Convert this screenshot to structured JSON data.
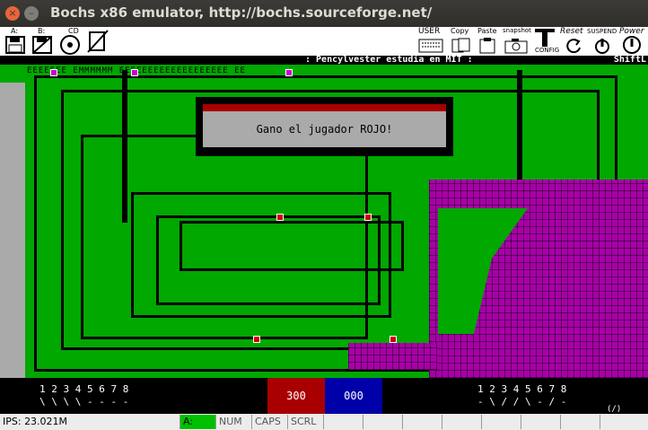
{
  "window": {
    "title": "Bochs x86 emulator, http://bochs.sourceforge.net/",
    "close_glyph": "×",
    "min_glyph": "–"
  },
  "toolbar": {
    "floppy_a": "A:",
    "floppy_b": "B:",
    "cdrom": "CD",
    "user": "USER",
    "copy": "Copy",
    "paste": "Paste",
    "snapshot": "snapshot",
    "config": "CONFIG",
    "reset": "Reset",
    "suspend": "SUSPEND",
    "power": "Power"
  },
  "game": {
    "status_center": ": Pencylvester estudia en MIT :",
    "status_right": "ShiftL",
    "top_row": "EEEEEEE EMMMMMM EEEEEEEEEEEEEEEEEEE EE",
    "dialog_message": "Gano el jugador ROJO!",
    "colors": {
      "field": "#00a800",
      "red_player": "#a80000",
      "blue_player": "#0000a8",
      "purple_area": "#a800a8",
      "dialog_panel": "#aaaaaa"
    }
  },
  "scoreboard": {
    "left_numbers": "1 2 3 4 5 6 7 8",
    "left_arrows": "\\ \\ \\ \\ - - - -",
    "right_numbers": "1 2 3 4 5 6 7 8",
    "right_arrows": "- \\ / / \\ - / -",
    "right_extra": "(/)",
    "red_score": "300",
    "blue_score": "000"
  },
  "statusbar": {
    "ips": "IPS: 23.021M",
    "drive": "A:",
    "num": "NUM",
    "caps": "CAPS",
    "scrl": "SCRL"
  }
}
